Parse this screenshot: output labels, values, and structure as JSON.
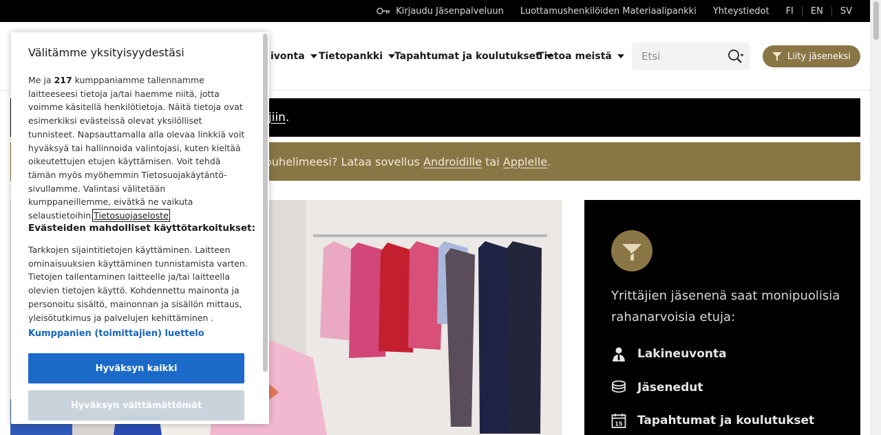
{
  "topbar": {
    "login": "Kirjaudu Jäsenpalveluun",
    "material_bank": "Luottamushenkilöiden Materiaalipankki",
    "contact": "Yhteystiedot",
    "langs": [
      "FI",
      "EN",
      "SV"
    ]
  },
  "nav": {
    "items": [
      "ivonta",
      "Tietopankki",
      "Tapahtumat ja koulutukset",
      "Tietoa meistä"
    ],
    "search_placeholder": "Etsi",
    "join": "Liity jäseneksi"
  },
  "banners": {
    "black_text": "jiin",
    "black_suffix": ".",
    "gold_prefix": "ouhelimeesi? Lataa sovellus ",
    "gold_link_android": "Androidille",
    "gold_mid": " tai ",
    "gold_link_apple": "Applelle",
    "gold_suffix": "."
  },
  "panel": {
    "intro": "Yrittäjien jäsenenä saat monipuolisia rahanarvoisia etuja:",
    "benefits": [
      {
        "label": "Lakineuvonta",
        "icon": "lawyer-icon"
      },
      {
        "label": "Jäsenedut",
        "icon": "coins-icon"
      },
      {
        "label": "Tapahtumat ja koulutukset",
        "icon": "calendar-icon"
      }
    ],
    "calendar_day": "15"
  },
  "consent": {
    "title": "Välitämme yksityisyydestäsi",
    "text_before_count": "Me ja ",
    "partner_count": "217",
    "text_after_count": " kumppaniamme tallennamme laitteeseesi tietoja ja/tai haemme niitä, jotta voimme käsitellä henkilötietoja. Näitä tietoja ovat esimerkiksi evästeissä olevat yksilölliset tunnisteet. Napsauttamalla alla olevaa linkkiä voit hyväksyä tai hallinnoida valintojasi, kuten kieltää oikeutettujen etujen käyttämisen. Voit tehdä tämän myös myöhemmin Tietosuojakäytäntö-sivullamme. Valintasi välitetään kumppaneillemme, eivätkä ne vaikuta selaustietoihin.",
    "policy_link": "Tietosuojaseloste",
    "purposes_heading": "Evästeiden mahdolliset käyttötarkoitukset:",
    "purposes_text": "Tarkkojen sijaintitietojen käyttäminen. Laitteen ominaisuuksien käyttäminen tunnistamista varten. Tietojen tallentaminen laitteelle ja/tai laitteella olevien tietojen käyttö. Kohdennettu mainonta ja personoitu sisältö, mainonnan ja sisällön mittaus, yleisötutkimus ja palvelujen kehittäminen .",
    "vendors_link": "Kumppanien (toimittajien) luettelo",
    "accept_all": "Hyväksyn kaikki",
    "accept_necessary": "Hyväksyn välttämättömät"
  },
  "colors": {
    "gold": "#8a7545",
    "accept_blue": "#1b6ac9",
    "necessary_grey": "#c9d3dc"
  }
}
